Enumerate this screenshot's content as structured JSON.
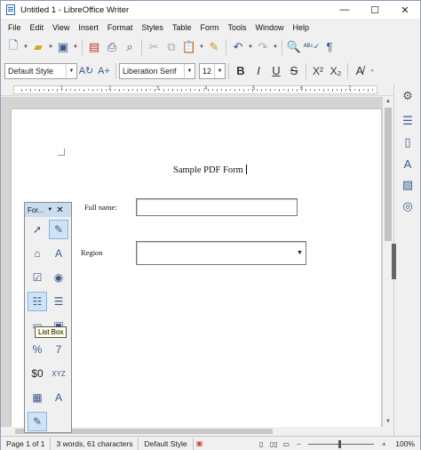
{
  "window": {
    "title": "Untitled 1 - LibreOffice Writer",
    "minimize": "—",
    "maximize": "☐",
    "close": "✕"
  },
  "menu": [
    "File",
    "Edit",
    "View",
    "Insert",
    "Format",
    "Styles",
    "Table",
    "Form",
    "Tools",
    "Window",
    "Help"
  ],
  "formatting": {
    "paragraph_style": "Default Style",
    "font_name": "Liberation Serif",
    "font_size": "12"
  },
  "ruler": {
    "numbers": [
      "1",
      "2",
      "3",
      "4",
      "5",
      "6",
      "7"
    ]
  },
  "document": {
    "title": "Sample PDF Form",
    "fields": [
      {
        "label": "Full name:",
        "control": "text-box",
        "value": ""
      },
      {
        "label": "Region",
        "control": "list-box",
        "value": ""
      }
    ]
  },
  "form_controls_toolbar": {
    "title": "For...",
    "tooltip": "List Box",
    "icons": [
      "select-icon",
      "design-mode-icon",
      "label-icon",
      "text-box-icon",
      "checkbox-icon",
      "option-button-icon",
      "list-box-icon",
      "combo-box-icon",
      "push-button-icon",
      "image-button-icon",
      "formatted-field-icon",
      "numerical-field-icon",
      "currency-field-icon",
      "pattern-field-icon",
      "table-control-icon",
      "text-field-icon",
      "more-controls-icon"
    ]
  },
  "statusbar": {
    "page": "Page 1 of 1",
    "words": "3 words, 61 characters",
    "page_style": "Default Style",
    "zoom": "100%"
  },
  "colors": {
    "accent": "#3a5a8a",
    "form_toolbar_header": "#c9ddf1",
    "selected_tool": "#cfe3f7",
    "tooltip_bg": "#ffffe1"
  }
}
